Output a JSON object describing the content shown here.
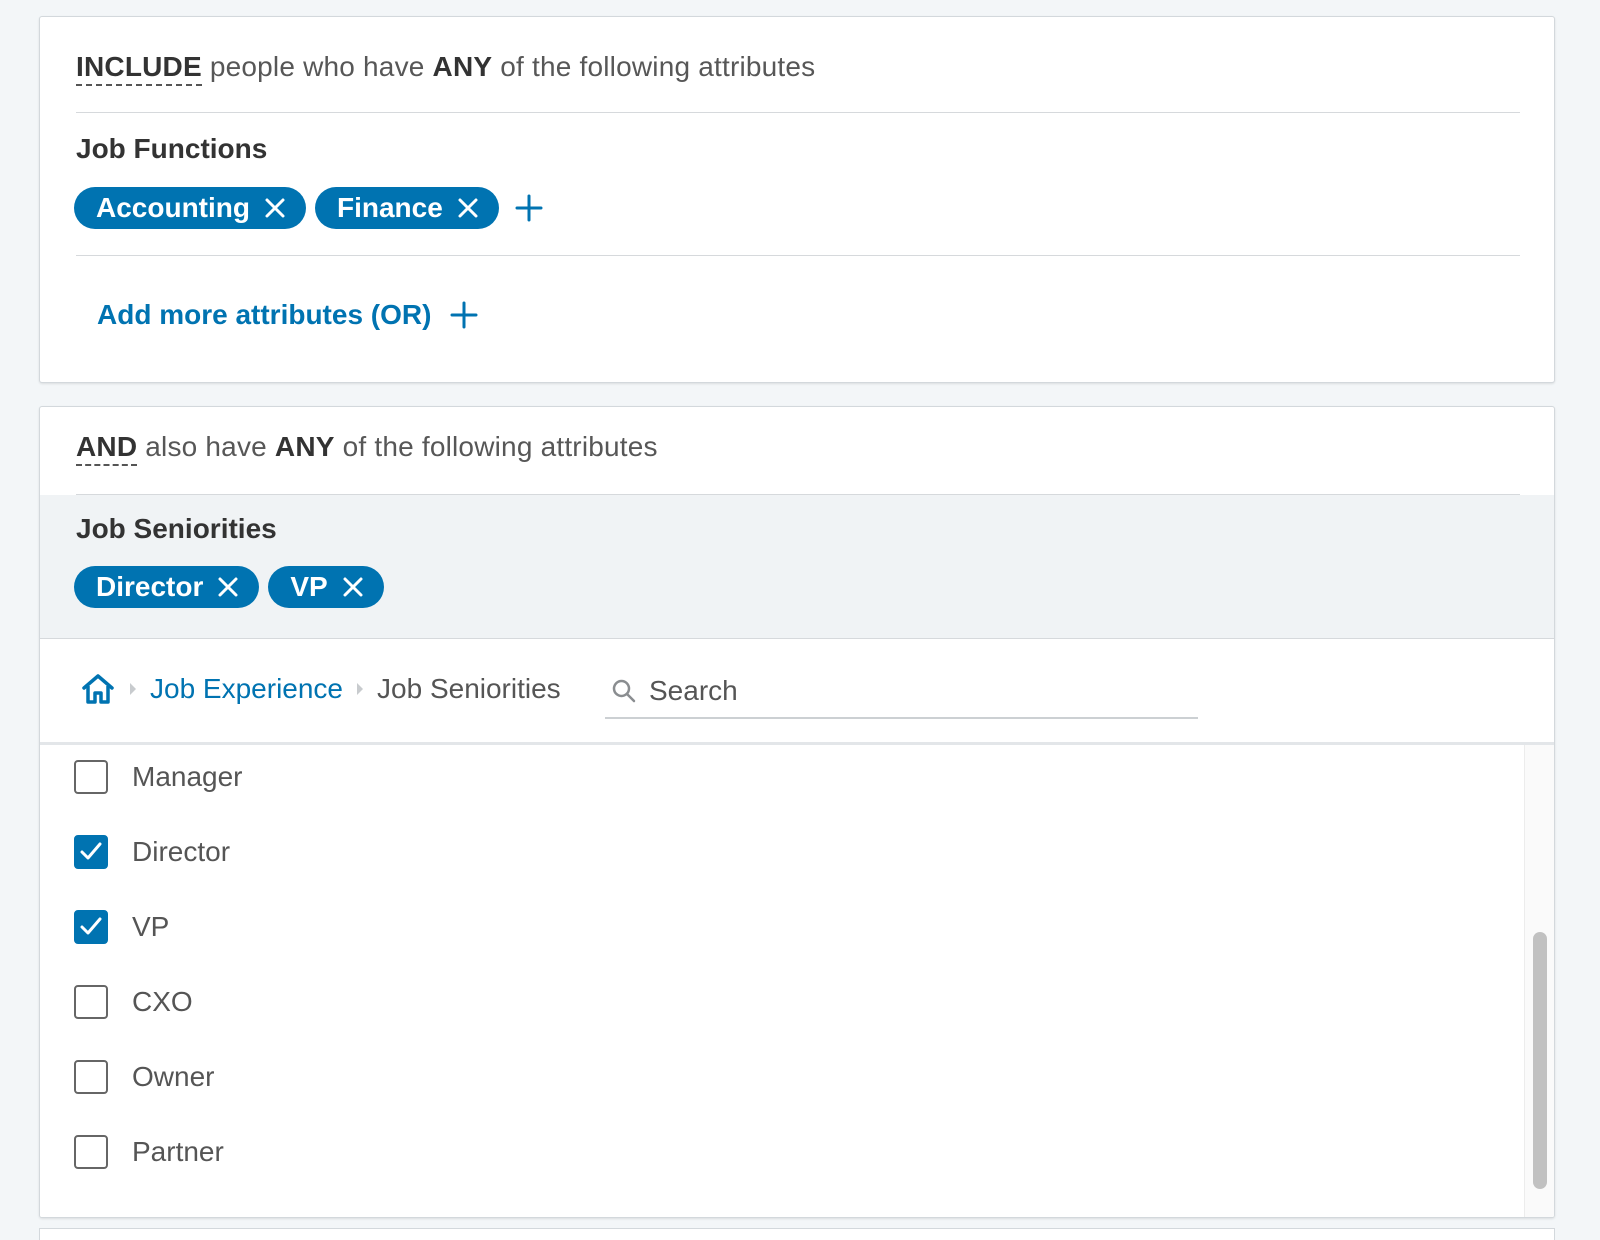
{
  "include_card": {
    "keyword": "INCLUDE",
    "text_before": "people who have",
    "quantifier": "ANY",
    "text_after": "of the following attributes",
    "group": {
      "title": "Job Functions",
      "pills": [
        "Accounting",
        "Finance"
      ]
    },
    "add_more_label": "Add more attributes (OR)"
  },
  "and_card": {
    "keyword": "AND",
    "text_before": "also have",
    "quantifier": "ANY",
    "text_after": "of the following attributes",
    "group": {
      "title": "Job Seniorities",
      "pills": [
        "Director",
        "VP"
      ]
    },
    "breadcrumb": {
      "home_icon": "home-icon",
      "link": "Job Experience",
      "current": "Job Seniorities"
    },
    "search": {
      "placeholder": "Search",
      "value": ""
    },
    "options": [
      {
        "label": "Manager",
        "checked": false
      },
      {
        "label": "Director",
        "checked": true
      },
      {
        "label": "VP",
        "checked": true
      },
      {
        "label": "CXO",
        "checked": false
      },
      {
        "label": "Owner",
        "checked": false
      },
      {
        "label": "Partner",
        "checked": false
      }
    ]
  },
  "colors": {
    "accent": "#0073b1",
    "page_bg": "#f3f6f8",
    "selected_band": "#f0f3f5"
  }
}
